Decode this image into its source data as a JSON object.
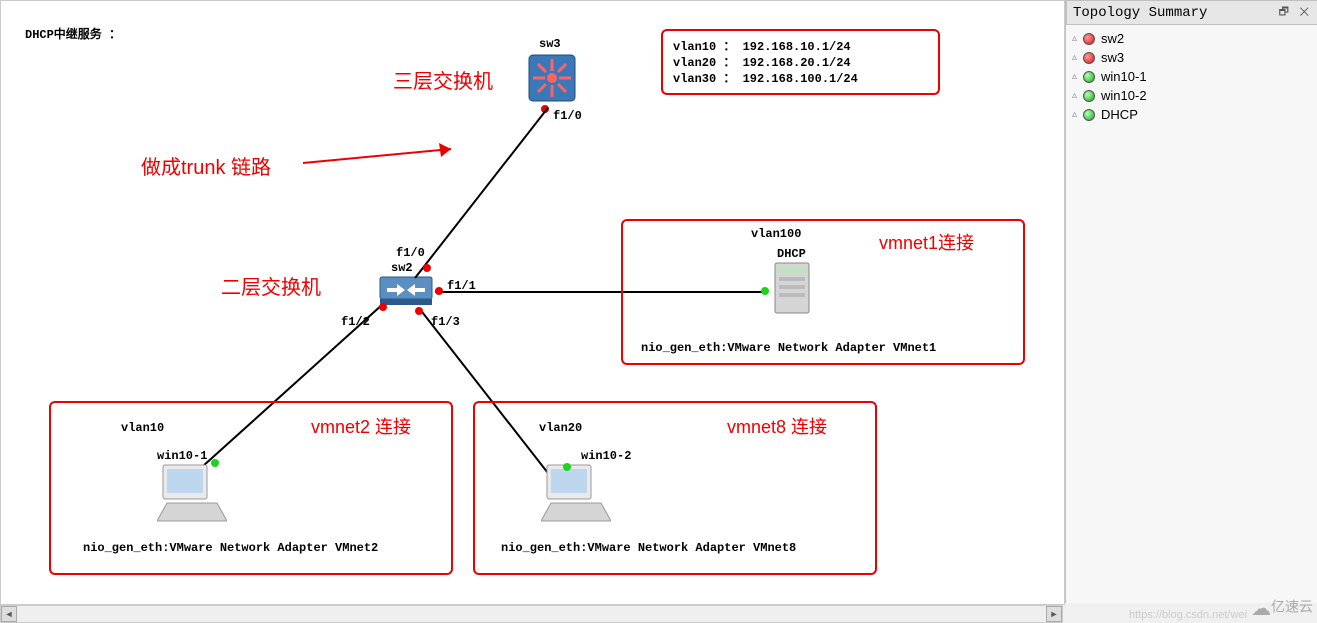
{
  "title": "DHCP中继服务 ：",
  "annotations": {
    "trunk": "做成trunk 链路",
    "l3_switch": "三层交换机",
    "l2_switch": "二层交换机",
    "vmnet1": "vmnet1连接",
    "vmnet2": "vmnet2 连接",
    "vmnet8": "vmnet8 连接"
  },
  "vlan_box": {
    "line1": "vlan10 ： 192.168.10.1/24",
    "line2": "vlan20 ： 192.168.20.1/24",
    "line3": "vlan30 ： 192.168.100.1/24"
  },
  "nodes": {
    "sw3": {
      "label": "sw3",
      "port": "f1/0"
    },
    "sw2": {
      "label": "sw2",
      "ports": {
        "p0": "f1/0",
        "p1": "f1/1",
        "p2": "f1/2",
        "p3": "f1/3"
      }
    },
    "dhcp": {
      "label": "DHCP",
      "vlan": "vlan100",
      "nic": "nio_gen_eth:VMware Network Adapter VMnet1"
    },
    "win10_1": {
      "label": "win10-1",
      "vlan": "vlan10",
      "nic": "nio_gen_eth:VMware Network Adapter VMnet2"
    },
    "win10_2": {
      "label": "win10-2",
      "vlan": "vlan20",
      "nic": "nio_gen_eth:VMware Network Adapter VMnet8"
    }
  },
  "sidebar": {
    "title": "Topology Summary",
    "btns": "🗗 ✕",
    "items": [
      {
        "status": "red",
        "name": "sw2"
      },
      {
        "status": "red",
        "name": "sw3"
      },
      {
        "status": "green",
        "name": "win10-1"
      },
      {
        "status": "green",
        "name": "win10-2"
      },
      {
        "status": "green",
        "name": "DHCP"
      }
    ]
  },
  "watermark": "https://blog.csdn.net/wei",
  "logo": "亿速云"
}
